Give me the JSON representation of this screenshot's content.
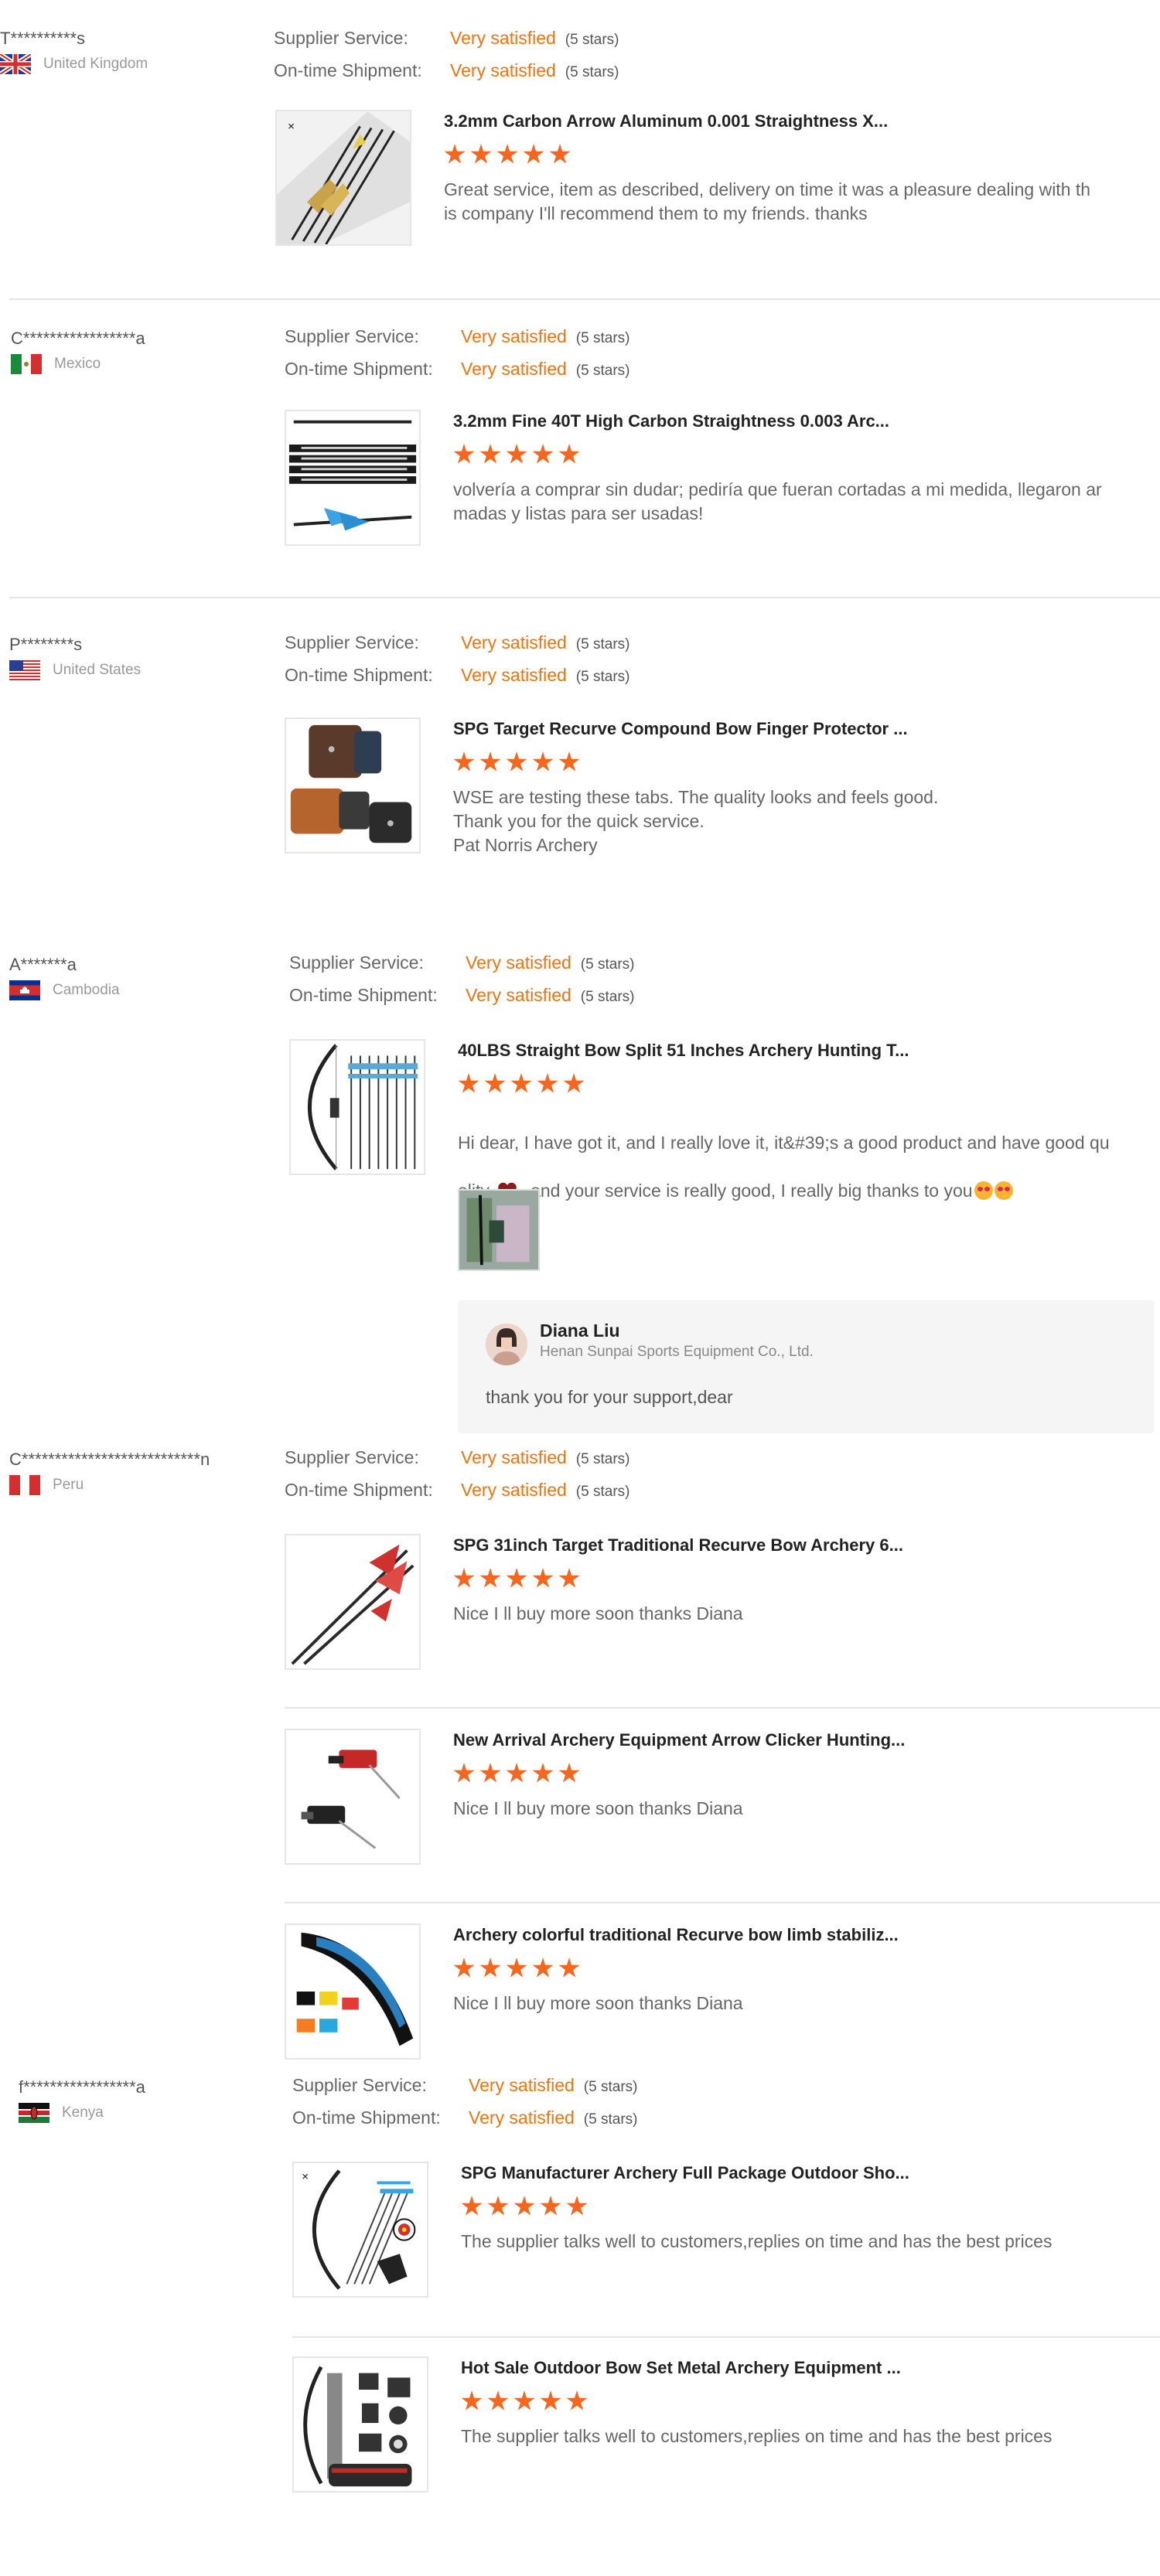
{
  "labels": {
    "supplier_service": "Supplier Service:",
    "ontime_shipment": "On-time Shipment:"
  },
  "colors": {
    "accent": "#f0730f",
    "star": "#f5671e",
    "divider": "#e5e5e5"
  },
  "reviews": [
    {
      "buyer": "T**********s",
      "country": "United Kingdom",
      "flag_icon": "uk-flag-icon",
      "supplier_service": "Very satisfied",
      "supplier_stars": "(5 stars)",
      "ontime_shipment": "Very satisfied",
      "shipment_stars": "(5 stars)",
      "products": [
        {
          "title": "3.2mm Carbon Arrow Aluminum 0.001 Straightness X...",
          "rating": 5,
          "text": "Great service, item as described, delivery on time it was a pleasure dealing with th\nis company I'll recommend them to my friends. thanks"
        }
      ]
    },
    {
      "buyer": "C*****************a",
      "country": "Mexico",
      "flag_icon": "mexico-flag-icon",
      "supplier_service": "Very satisfied",
      "supplier_stars": "(5 stars)",
      "ontime_shipment": "Very satisfied",
      "shipment_stars": "(5 stars)",
      "products": [
        {
          "title": "3.2mm Fine 40T High Carbon Straightness 0.003 Arc...",
          "rating": 5,
          "text": "volvería a comprar sin dudar; pediría que fueran cortadas a mi medida, llegaron ar\nmadas y listas para ser usadas!"
        }
      ]
    },
    {
      "buyer": "P********s",
      "country": "United States",
      "flag_icon": "usa-flag-icon",
      "supplier_service": "Very satisfied",
      "supplier_stars": "(5 stars)",
      "ontime_shipment": "Very satisfied",
      "shipment_stars": "(5 stars)",
      "products": [
        {
          "title": "SPG Target Recurve Compound Bow Finger Protector ...",
          "rating": 5,
          "text": "WSE are testing these tabs.  The quality looks and feels good.\nThank you for the quick service.\nPat Norris Archery"
        }
      ]
    },
    {
      "buyer": "A*******a",
      "country": "Cambodia",
      "flag_icon": "cambodia-flag-icon",
      "supplier_service": "Very satisfied",
      "supplier_stars": "(5 stars)",
      "ontime_shipment": "Very satisfied",
      "shipment_stars": "(5 stars)",
      "products": [
        {
          "title": "40LBS Straight Bow Split 51 Inches Archery Hunting T...",
          "rating": 5,
          "text_line1": "Hi dear, I have got it, and I really love it, it&#39;s a good product and have good qu",
          "text_line2_a": "ality ",
          "text_line2_b": ", and your service is really good, I really big thanks to you"
        }
      ],
      "reply": {
        "name": "Diana Liu",
        "company": "Henan Sunpai Sports Equipment Co., Ltd.",
        "text": "thank you for your support,dear"
      }
    },
    {
      "buyer": "C***************************n",
      "country": "Peru",
      "flag_icon": "peru-flag-icon",
      "supplier_service": "Very satisfied",
      "supplier_stars": "(5 stars)",
      "ontime_shipment": "Very satisfied",
      "shipment_stars": "(5 stars)",
      "products": [
        {
          "title": "SPG 31inch Target Traditional Recurve Bow Archery 6...",
          "rating": 5,
          "text": "Nice I ll buy more soon thanks Diana"
        },
        {
          "title": "New Arrival Archery Equipment Arrow Clicker Hunting...",
          "rating": 5,
          "text": "Nice I ll buy more soon thanks Diana"
        },
        {
          "title": "Archery colorful traditional Recurve bow limb stabiliz...",
          "rating": 5,
          "text": "Nice I ll buy more soon thanks Diana"
        }
      ]
    },
    {
      "buyer": "f*****************a",
      "country": "Kenya",
      "flag_icon": "kenya-flag-icon",
      "supplier_service": "Very satisfied",
      "supplier_stars": "(5 stars)",
      "ontime_shipment": "Very satisfied",
      "shipment_stars": "(5 stars)",
      "products": [
        {
          "title": "SPG Manufacturer Archery Full Package Outdoor Sho...",
          "rating": 5,
          "text": "The supplier talks well to customers,replies on time and has the best prices"
        },
        {
          "title": "Hot Sale Outdoor Bow Set Metal Archery Equipment ...",
          "rating": 5,
          "text": "The supplier talks well to customers,replies on time and has the best prices"
        }
      ]
    }
  ]
}
